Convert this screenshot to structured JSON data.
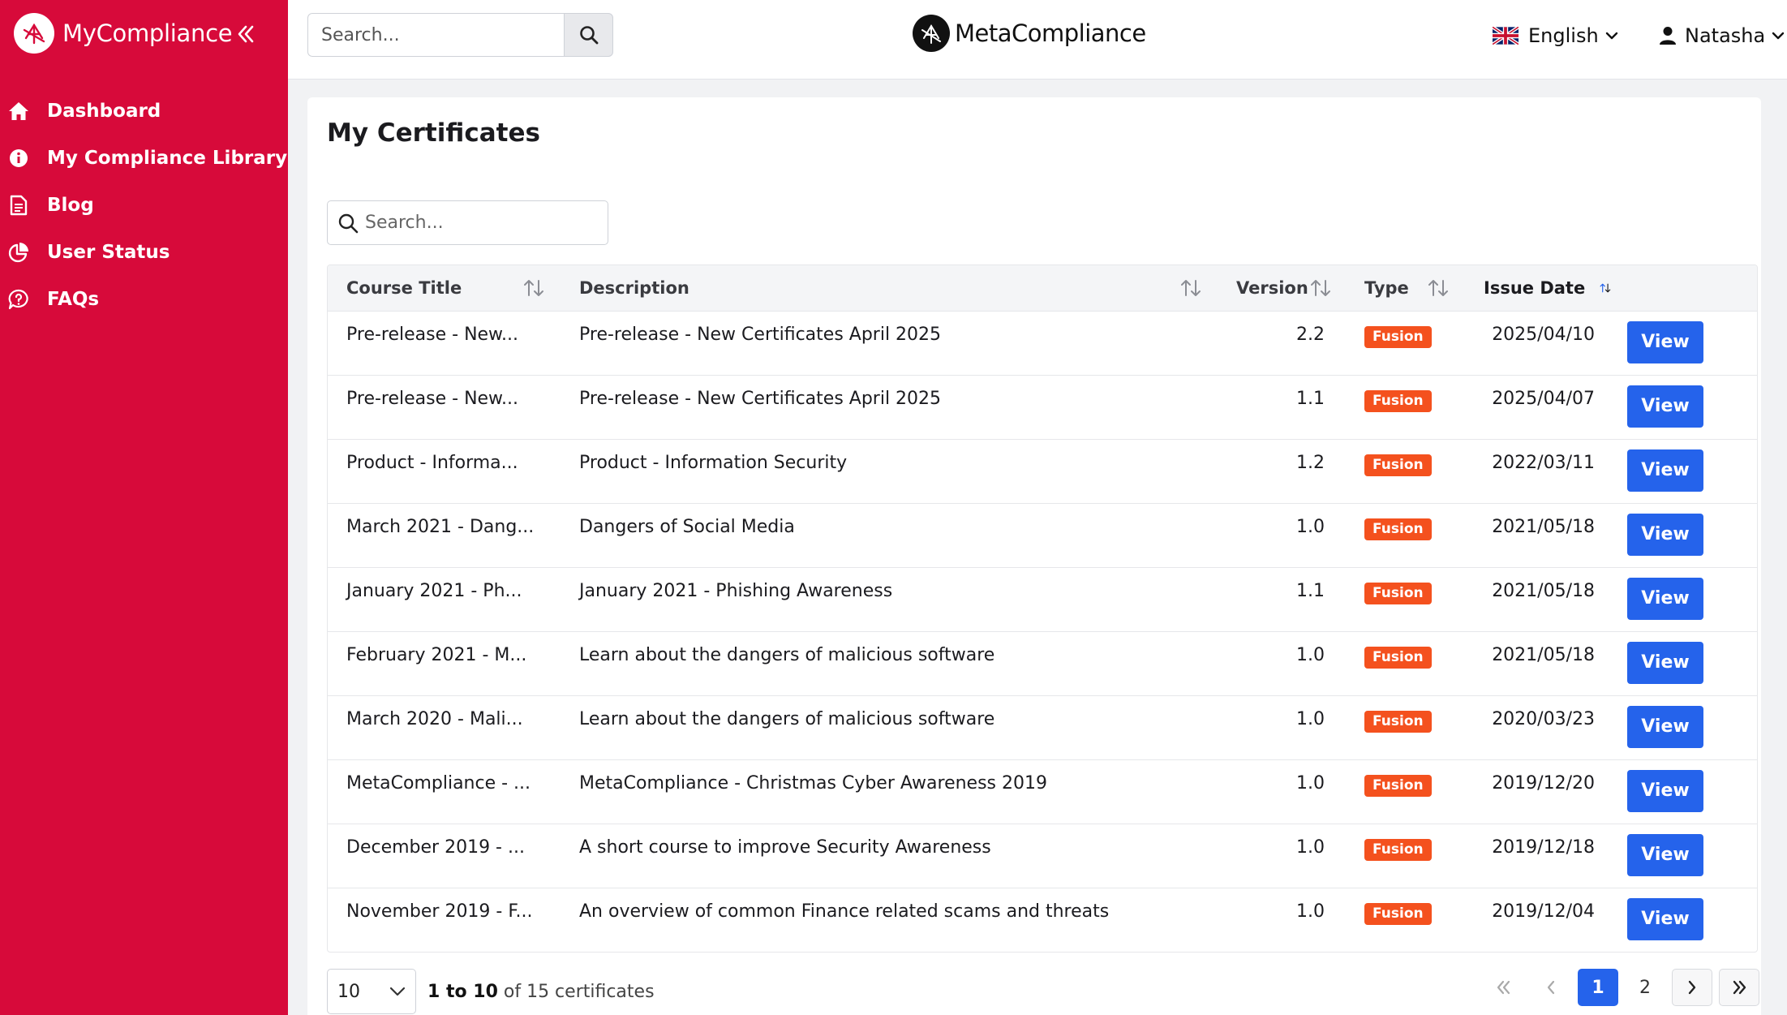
{
  "sidebar": {
    "brand": "MyCompliance",
    "items": [
      {
        "label": "Dashboard",
        "icon": "home-icon"
      },
      {
        "label": "My Compliance Library",
        "icon": "info-icon"
      },
      {
        "label": "Blog",
        "icon": "document-icon"
      },
      {
        "label": "User Status",
        "icon": "pie-chart-icon"
      },
      {
        "label": "FAQs",
        "icon": "chat-question-icon"
      }
    ],
    "color": "#d70a3a"
  },
  "header": {
    "search_placeholder": "Search...",
    "logo_text": "MetaCompliance",
    "language": "English",
    "user": "Natasha"
  },
  "main": {
    "title": "My Certificates",
    "search_placeholder": "Search...",
    "columns": {
      "course_title": "Course Title",
      "description": "Description",
      "version": "Version",
      "type": "Type",
      "issue_date": "Issue Date"
    },
    "view_label": "View",
    "rows": [
      {
        "course": "Pre-release - New...",
        "description": "Pre-release - New Certificates April 2025",
        "version": "2.2",
        "type": "Fusion",
        "date": "2025/04/10"
      },
      {
        "course": "Pre-release - New...",
        "description": "Pre-release - New Certificates April 2025",
        "version": "1.1",
        "type": "Fusion",
        "date": "2025/04/07"
      },
      {
        "course": "Product - Informa...",
        "description": "Product - Information Security",
        "version": "1.2",
        "type": "Fusion",
        "date": "2022/03/11"
      },
      {
        "course": "March 2021 - Dang...",
        "description": "Dangers of Social Media",
        "version": "1.0",
        "type": "Fusion",
        "date": "2021/05/18"
      },
      {
        "course": "January 2021 - Ph...",
        "description": "January 2021 - Phishing Awareness",
        "version": "1.1",
        "type": "Fusion",
        "date": "2021/05/18"
      },
      {
        "course": "February 2021 - M...",
        "description": "Learn about the dangers of malicious software",
        "version": "1.0",
        "type": "Fusion",
        "date": "2021/05/18"
      },
      {
        "course": "March 2020 - Mali...",
        "description": "Learn about the dangers of malicious software",
        "version": "1.0",
        "type": "Fusion",
        "date": "2020/03/23"
      },
      {
        "course": "MetaCompliance - ...",
        "description": "MetaCompliance - Christmas Cyber Awareness 2019",
        "version": "1.0",
        "type": "Fusion",
        "date": "2019/12/20"
      },
      {
        "course": "December 2019 - ...",
        "description": "A short course to improve Security Awareness",
        "version": "1.0",
        "type": "Fusion",
        "date": "2019/12/18"
      },
      {
        "course": "November 2019 - F...",
        "description": "An overview of common Finance related scams and threats",
        "version": "1.0",
        "type": "Fusion",
        "date": "2019/12/04"
      }
    ]
  },
  "footer": {
    "page_size": "10",
    "range": "1 to 10",
    "total_text": "of 15 certificates",
    "pages": [
      "1",
      "2"
    ],
    "current_page": "1"
  },
  "colors": {
    "accent": "#2563eb",
    "badge": "#f4511e"
  }
}
